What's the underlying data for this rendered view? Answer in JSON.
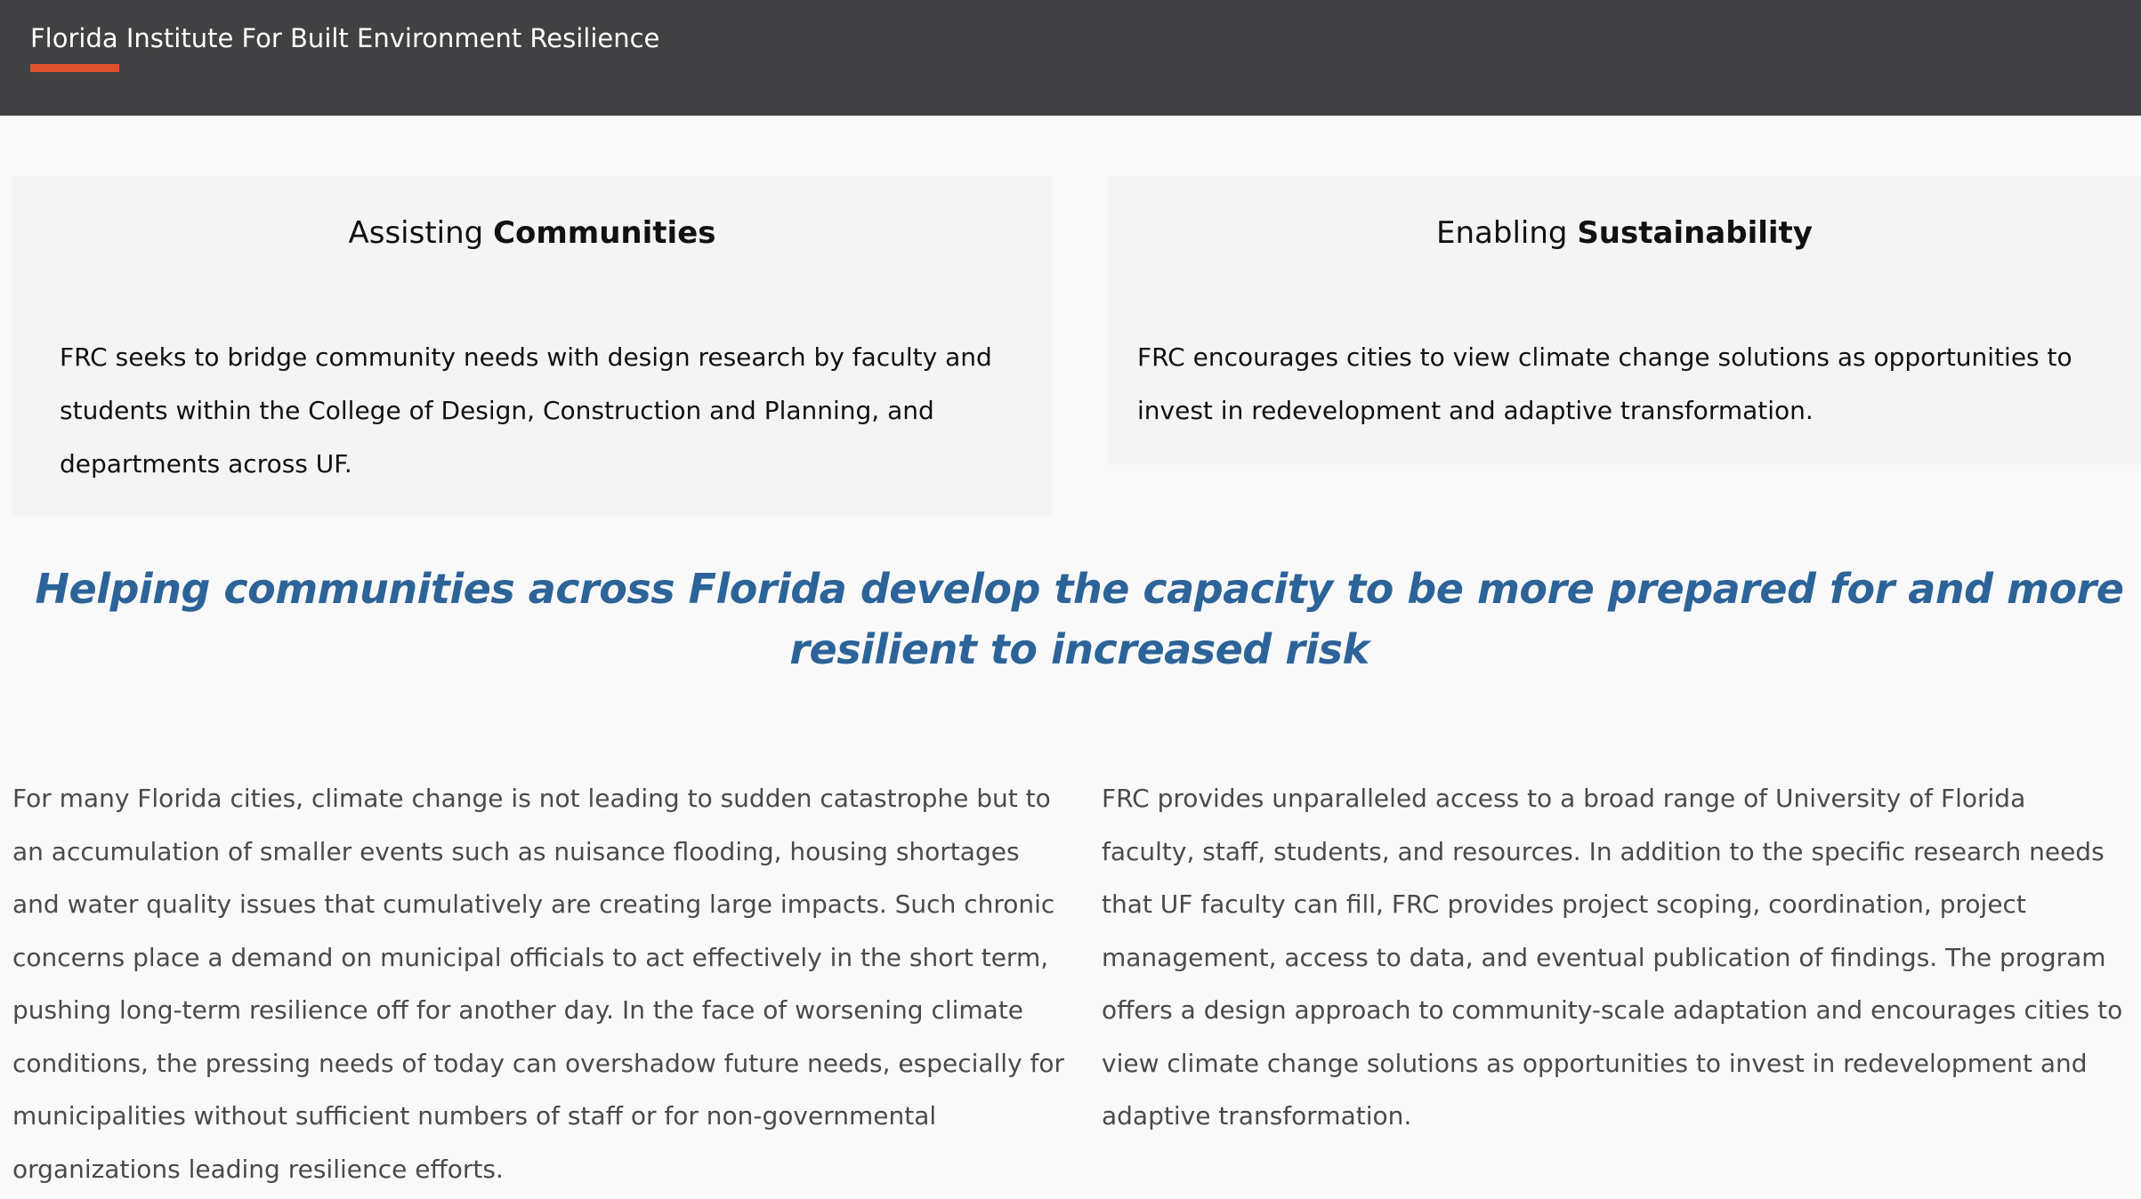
{
  "header": {
    "site_title": "Florida Institute For Built Environment Resilience"
  },
  "cards": [
    {
      "title_prefix": "Assisting",
      "title_emphasis": "Communities",
      "body": "FRC seeks to bridge community needs with design research by faculty and students within the College of Design, Construction and Planning, and departments across UF."
    },
    {
      "title_prefix": "Enabling",
      "title_emphasis": "Sustainability",
      "body": "FRC encourages cities to view climate change solutions as opportunities to invest in redevelopment and adaptive transformation."
    }
  ],
  "tagline": "Helping communities across Florida develop the capacity to be more prepared for and more resilient to increased risk",
  "paragraphs": [
    "For many Florida cities, climate change is not leading to sudden catastrophe but to an accumulation of smaller events such as nuisance flooding, housing shortages and water quality issues that cumulatively are creating large impacts. Such chronic concerns place a demand on municipal officials to act effectively in the short term, pushing long-term resilience off for another day. In the face of worsening climate conditions, the pressing needs of today can overshadow future needs, especially for municipalities without sufficient numbers of staff or for non-governmental organizations leading resilience efforts.",
    "FRC provides unparalleled access to a broad range of University of Florida faculty, staff, students, and resources. In addition to the specific research needs that UF faculty can fill, FRC provides project scoping, coordination, project management, access to data, and eventual publication of findings. The program offers a design approach to community-scale adaptation and encourages cities to view climate change solutions as opportunities to invest in redevelopment and adaptive transformation."
  ],
  "colors": {
    "header_bg": "#414143",
    "accent": "#e0512d",
    "tagline": "#2c6398",
    "page_bg": "#f9f9f9",
    "card_bg": "#f4f4f4"
  }
}
